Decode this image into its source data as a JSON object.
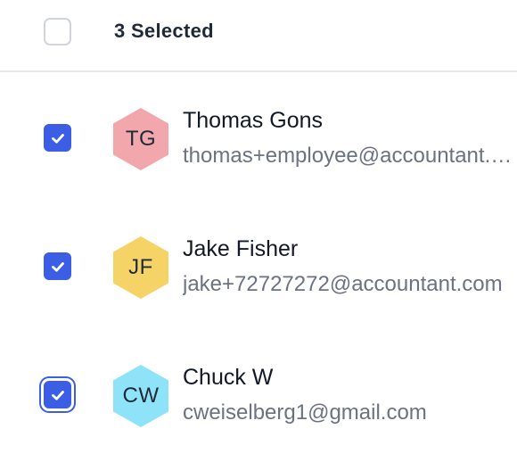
{
  "header": {
    "selected_label": "3 Selected",
    "select_all_checked": false
  },
  "colors": {
    "checkbox_checked": "#3b5ee5",
    "divider": "#e5e7eb",
    "email_text": "#6b7280"
  },
  "users": [
    {
      "initials": "TG",
      "name": "Thomas Gons",
      "email": "thomas+employee@accountant.com",
      "checked": true,
      "avatar_color": "#f2a7ad",
      "focused": false
    },
    {
      "initials": "JF",
      "name": "Jake Fisher",
      "email": "jake+72727272@accountant.com",
      "checked": true,
      "avatar_color": "#f6d366",
      "focused": false
    },
    {
      "initials": "CW",
      "name": "Chuck W",
      "email": "cweiselberg1@gmail.com",
      "checked": true,
      "avatar_color": "#8ee3f8",
      "focused": true
    }
  ]
}
